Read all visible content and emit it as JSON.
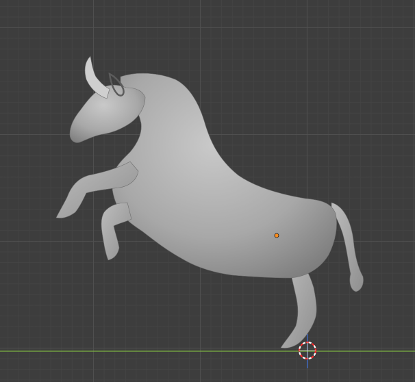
{
  "viewport": {
    "name": "3D Viewport",
    "background_color": "#3d3d3d",
    "grid_minor_color": "#444444",
    "grid_major_color": "#505050",
    "x_axis_color": "#7cb342",
    "z_axis_color": "#3d6fd8"
  },
  "object": {
    "name": "bull",
    "shading": "solid",
    "base_color": "#a9a9a9",
    "origin_color": "#ff8c1a"
  },
  "cursor_3d": {
    "primary_color": "#ff2d2d",
    "secondary_color": "#ffffff"
  }
}
